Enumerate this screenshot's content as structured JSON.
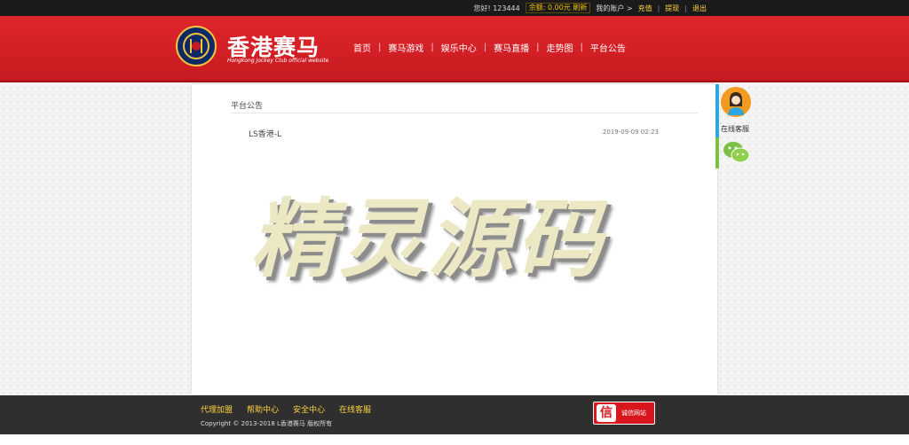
{
  "topbar": {
    "greeting": "您好! 123444",
    "balance": "余额: 0.00元 刷新",
    "account": "我的账户 >",
    "recharge": "充值",
    "withdraw": "提现",
    "logout": "退出"
  },
  "header": {
    "brand_title": "香港赛马",
    "brand_subtitle": "Hongkong Jockey Club official website",
    "logo_icon": "hkjc-crest-icon",
    "nav": [
      "首页",
      "赛马游戏",
      "娱乐中心",
      "赛马直播",
      "走势图",
      "平台公告"
    ]
  },
  "panel": {
    "title": "平台公告",
    "notice_title": "LS香港-L",
    "notice_date": "2019-09-09 02:23"
  },
  "watermark": "精灵源码",
  "service": {
    "online_cs": "在线客服",
    "cs_icon": "customer-service-avatar-icon",
    "wechat_icon": "wechat-icon"
  },
  "footer": {
    "links": [
      "代理加盟",
      "帮助中心",
      "安全中心",
      "在线客服"
    ],
    "copyright": "Copyright © 2013-2018 L香港赛马 版权所有",
    "trust_badge": "诚信网站",
    "trust_icon_char": "信"
  },
  "colors": {
    "header_red": "#d0202a",
    "link_yellow": "#ffd23c",
    "footer_dark": "#2f2f2f",
    "cs_blue": "#2fa7e0",
    "wechat_green": "#7cc143"
  }
}
